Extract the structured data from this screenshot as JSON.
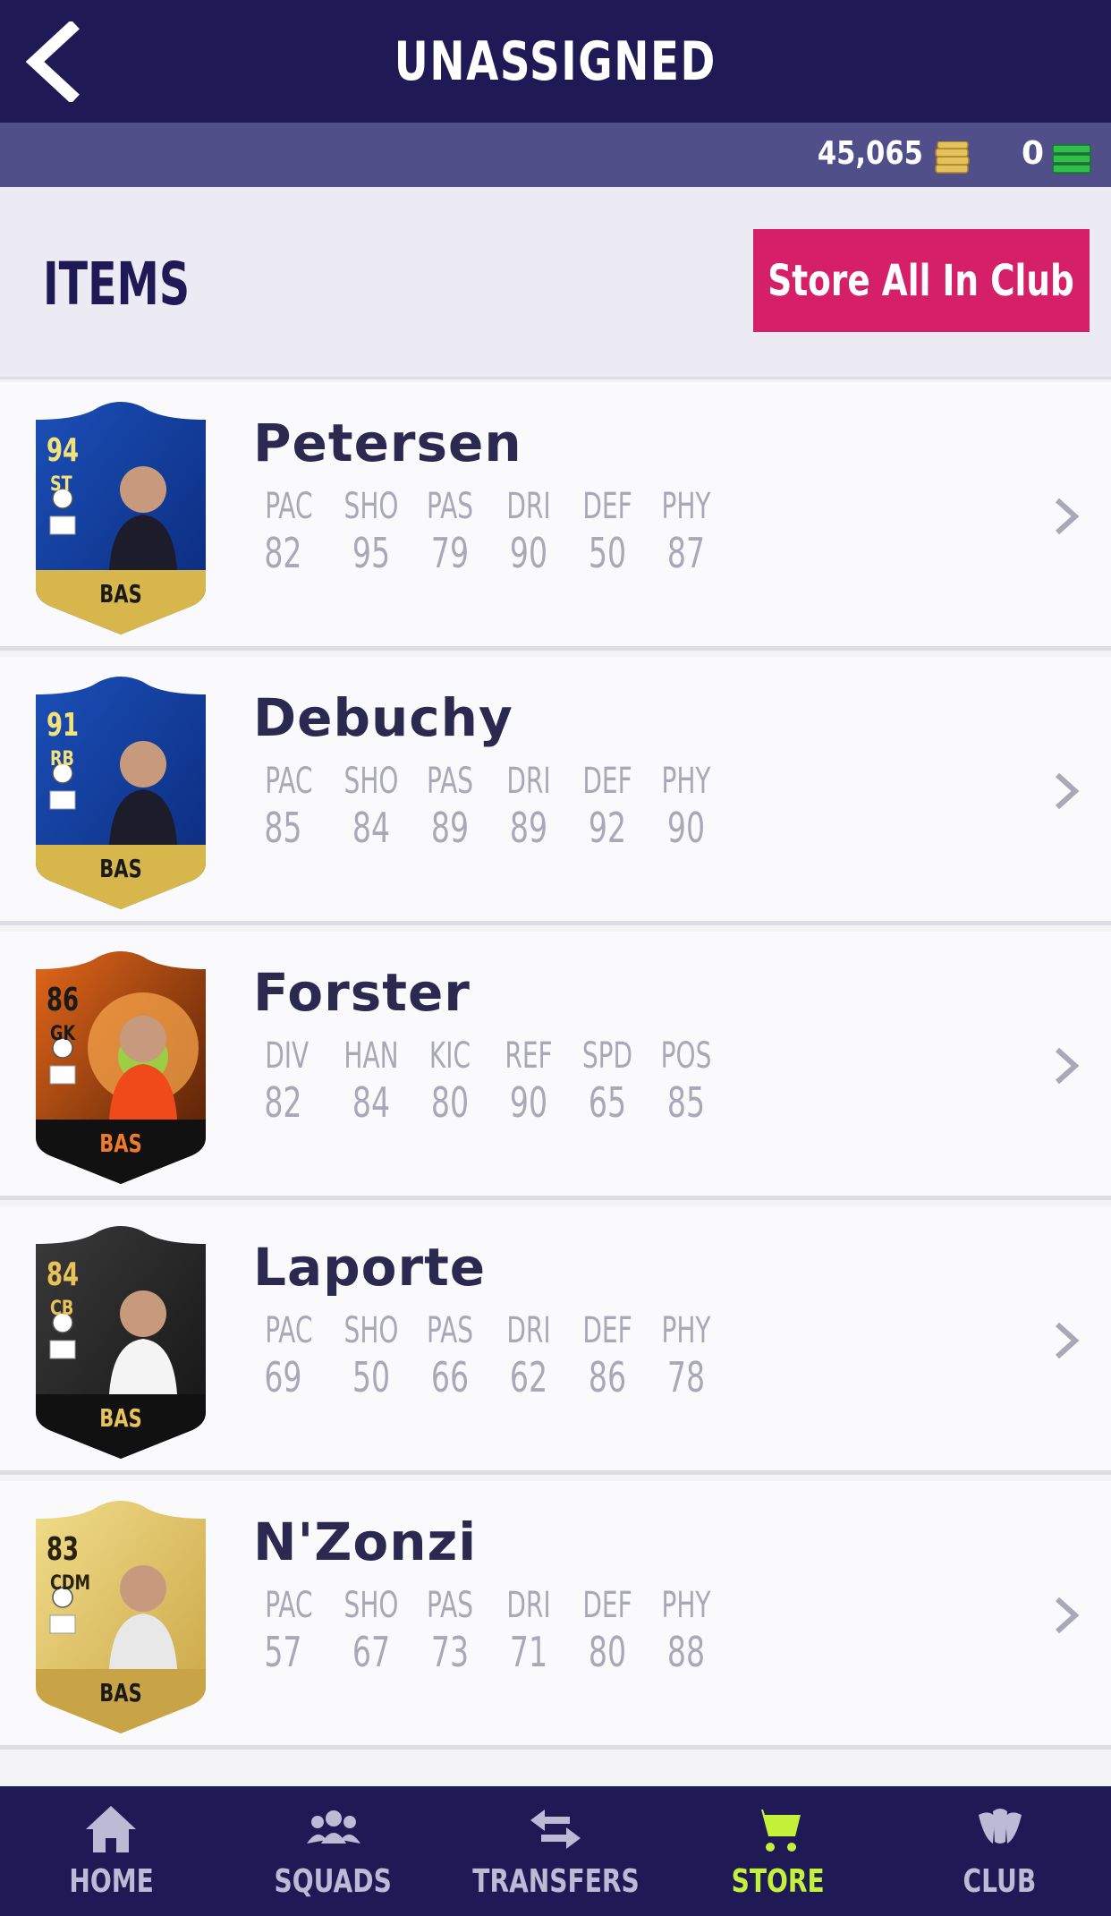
{
  "header": {
    "title": "UNASSIGNED"
  },
  "currency": {
    "coins": "45,065",
    "points": "0"
  },
  "items_section": {
    "label": "ITEMS",
    "store_all_label": "Store All In Club"
  },
  "players": [
    {
      "name": "Petersen",
      "rating": "94",
      "position": "ST",
      "chem": "BAS",
      "stat_labels": [
        "PAC",
        "SHO",
        "PAS",
        "DRI",
        "DEF",
        "PHY"
      ],
      "stat_values": [
        "82",
        "95",
        "79",
        "90",
        "50",
        "87"
      ]
    },
    {
      "name": "Debuchy",
      "rating": "91",
      "position": "RB",
      "chem": "BAS",
      "stat_labels": [
        "PAC",
        "SHO",
        "PAS",
        "DRI",
        "DEF",
        "PHY"
      ],
      "stat_values": [
        "85",
        "84",
        "89",
        "89",
        "92",
        "90"
      ]
    },
    {
      "name": "Forster",
      "rating": "86",
      "position": "GK",
      "chem": "BAS",
      "stat_labels": [
        "DIV",
        "HAN",
        "KIC",
        "REF",
        "SPD",
        "POS"
      ],
      "stat_values": [
        "82",
        "84",
        "80",
        "90",
        "65",
        "85"
      ]
    },
    {
      "name": "Laporte",
      "rating": "84",
      "position": "CB",
      "chem": "BAS",
      "stat_labels": [
        "PAC",
        "SHO",
        "PAS",
        "DRI",
        "DEF",
        "PHY"
      ],
      "stat_values": [
        "69",
        "50",
        "66",
        "62",
        "86",
        "78"
      ]
    },
    {
      "name": "N'Zonzi",
      "rating": "83",
      "position": "CDM",
      "chem": "BAS",
      "stat_labels": [
        "PAC",
        "SHO",
        "PAS",
        "DRI",
        "DEF",
        "PHY"
      ],
      "stat_values": [
        "57",
        "67",
        "73",
        "71",
        "80",
        "88"
      ]
    }
  ],
  "nav": {
    "items": [
      {
        "label": "HOME",
        "icon": "home-icon"
      },
      {
        "label": "SQUADS",
        "icon": "squads-icon"
      },
      {
        "label": "TRANSFERS",
        "icon": "transfers-icon"
      },
      {
        "label": "STORE",
        "icon": "cart-icon",
        "active": true
      },
      {
        "label": "CLUB",
        "icon": "club-icon"
      }
    ]
  },
  "colors": {
    "header": "#1f1a55",
    "accent_button": "#d61f69",
    "active_nav": "#c4f13a"
  }
}
